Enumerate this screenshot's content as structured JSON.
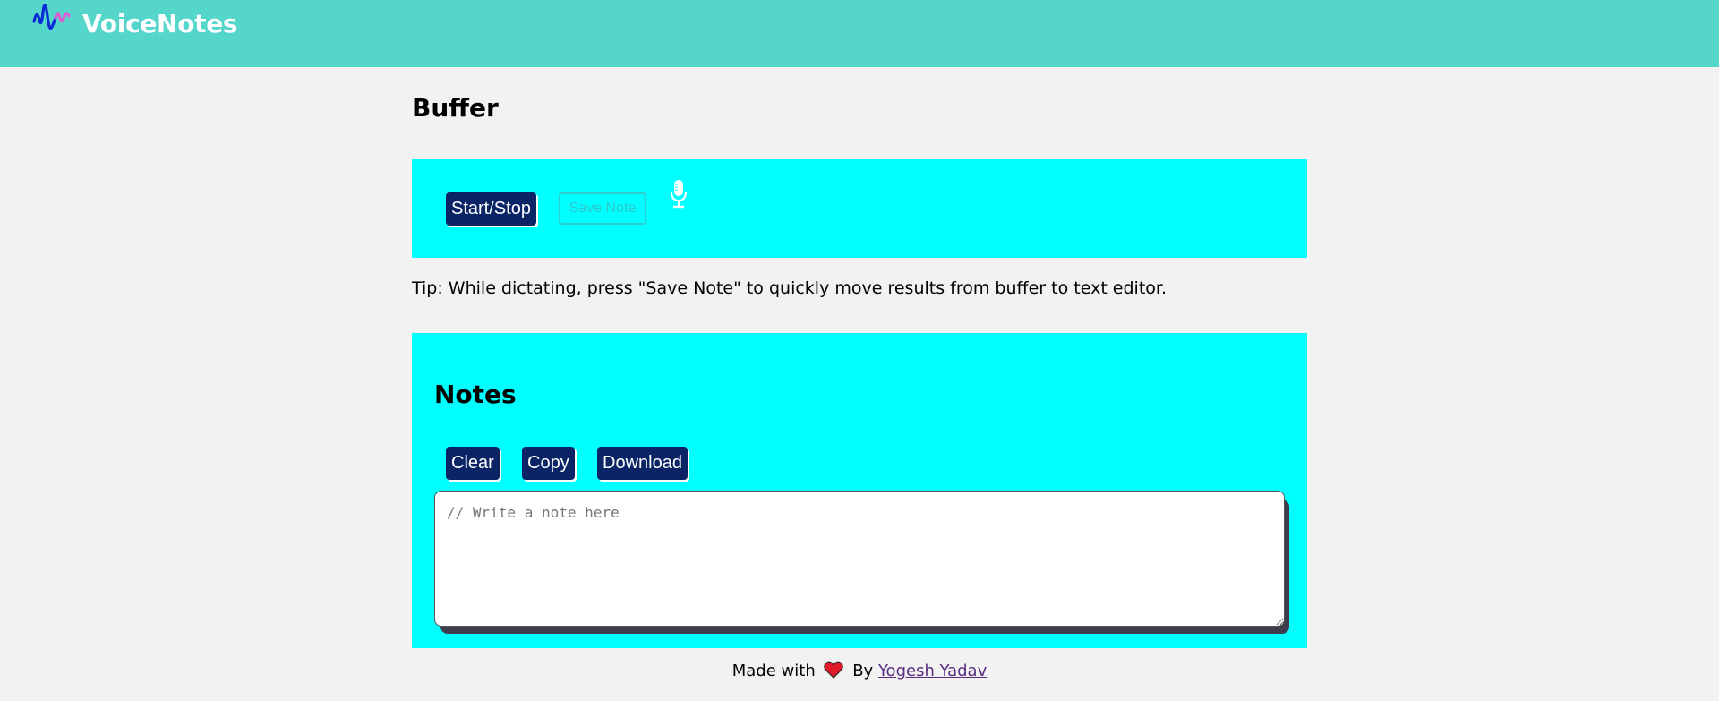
{
  "header": {
    "app_name": "VoiceNotes",
    "background_color": "#55d6cb",
    "logo_icon": "sound-wave-icon"
  },
  "buffer": {
    "title": "Buffer",
    "start_stop_label": "Start/Stop",
    "save_note_label": "Save Note",
    "save_note_enabled": false,
    "mic_icon": "microphone-icon",
    "panel_color": "#00ffff"
  },
  "tip": {
    "text": "Tip: While dictating, press \"Save Note\" to quickly move results from buffer to text editor."
  },
  "notes": {
    "title": "Notes",
    "clear_label": "Clear",
    "copy_label": "Copy",
    "download_label": "Download",
    "editor_placeholder": "// Write a note here",
    "editor_value": ""
  },
  "footer": {
    "made_with": "Made with",
    "heart_icon": "heart-icon",
    "by": "By",
    "author_link": "Yogesh Yadav"
  },
  "colors": {
    "button_bg": "#0b2466",
    "page_bg": "#f2f2f2"
  }
}
